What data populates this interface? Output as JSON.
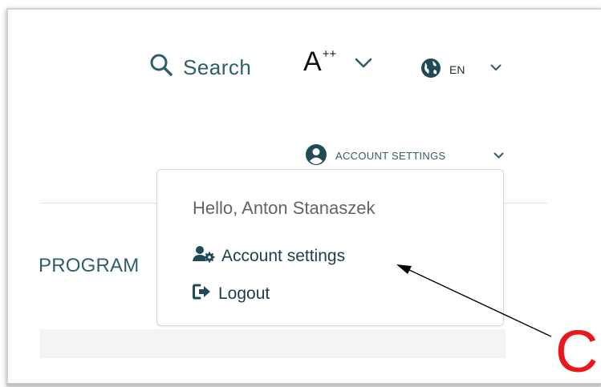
{
  "header": {
    "search_label": "Search",
    "font_size": {
      "base": "A",
      "sup": "++"
    },
    "language": "EN",
    "account_label": "ACCOUNT SETTINGS"
  },
  "page": {
    "program_title": "PROGRAM"
  },
  "dropdown": {
    "greeting": "Hello, Anton Stanaszek",
    "items": [
      {
        "label": "Account settings",
        "icon": "user-cog-icon"
      },
      {
        "label": "Logout",
        "icon": "logout-icon"
      }
    ]
  },
  "annotation": {
    "letter": "C",
    "color": "#e8181c"
  },
  "colors": {
    "accent": "#2f5f6a",
    "annotation": "#e8181c"
  }
}
